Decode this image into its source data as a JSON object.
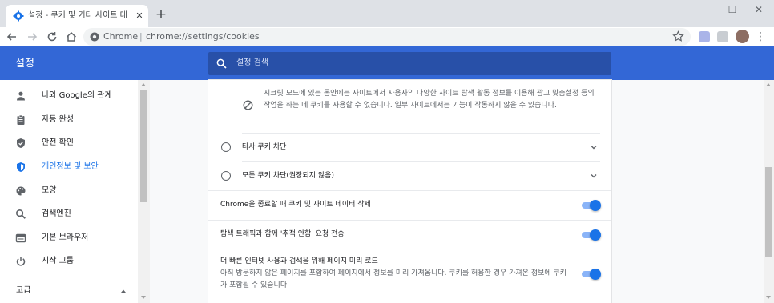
{
  "browser": {
    "tab_title": "설정 - 쿠키 및 기타 사이트 데이터",
    "new_tab_symbol": "+",
    "close_symbol": "✕",
    "window_controls": {
      "minimize": "—",
      "maximize": "☐",
      "close": "✕"
    },
    "omnibox": {
      "site_name": "Chrome",
      "separator": "|",
      "url": "chrome://settings/cookies"
    },
    "menu_symbol": "⋮"
  },
  "header": {
    "title": "설정",
    "search_placeholder": "설정 검색"
  },
  "sidebar": {
    "items": [
      {
        "label": "나와 Google의 관계",
        "icon": "person-icon",
        "active": false
      },
      {
        "label": "자동 완성",
        "icon": "clipboard-icon",
        "active": false
      },
      {
        "label": "안전 확인",
        "icon": "shield-check-icon",
        "active": false
      },
      {
        "label": "개인정보 및 보안",
        "icon": "shield-icon",
        "active": true
      },
      {
        "label": "모양",
        "icon": "palette-icon",
        "active": false
      },
      {
        "label": "검색엔진",
        "icon": "search-icon",
        "active": false
      },
      {
        "label": "기본 브라우저",
        "icon": "browser-icon",
        "active": false
      },
      {
        "label": "시작 그룹",
        "icon": "power-icon",
        "active": false
      }
    ],
    "advanced_label": "고급"
  },
  "content": {
    "incognito_note": "시크릿 모드에 있는 동안에는 사이트에서 사용자의 다양한 사이트 탐색 활동 정보를 이용해 광고 맞춤설정 등의 작업을 하는 데 쿠키를 사용할 수 없습니다. 일부 사이트에서는 기능이 작동하지 않을 수 있습니다.",
    "radio_options": [
      {
        "label": "타사 쿠키 차단",
        "checked": false
      },
      {
        "label": "모든 쿠키 차단(권장되지 않음)",
        "checked": false
      }
    ],
    "toggles": [
      {
        "label": "Chrome을 종료할 때 쿠키 및 사이트 데이터 삭제",
        "sublabel": "",
        "on": true
      },
      {
        "label": "탐색 트래픽과 함께 '추적 안함' 요청 전송",
        "sublabel": "",
        "on": true
      },
      {
        "label": "더 빠른 인터넷 사용과 검색을 위해 페이지 미리 로드",
        "sublabel": "아직 방문하지 않은 페이지를 포함하여 페이지에서 정보를 미리 가져옵니다. 쿠키를 허용한 경우 가져온 정보에 쿠키가 포함될 수 있습니다.",
        "on": true
      }
    ]
  },
  "colors": {
    "header_blue": "#3367d6",
    "accent_blue": "#1a73e8",
    "toggle_track": "#8ab4f8"
  }
}
